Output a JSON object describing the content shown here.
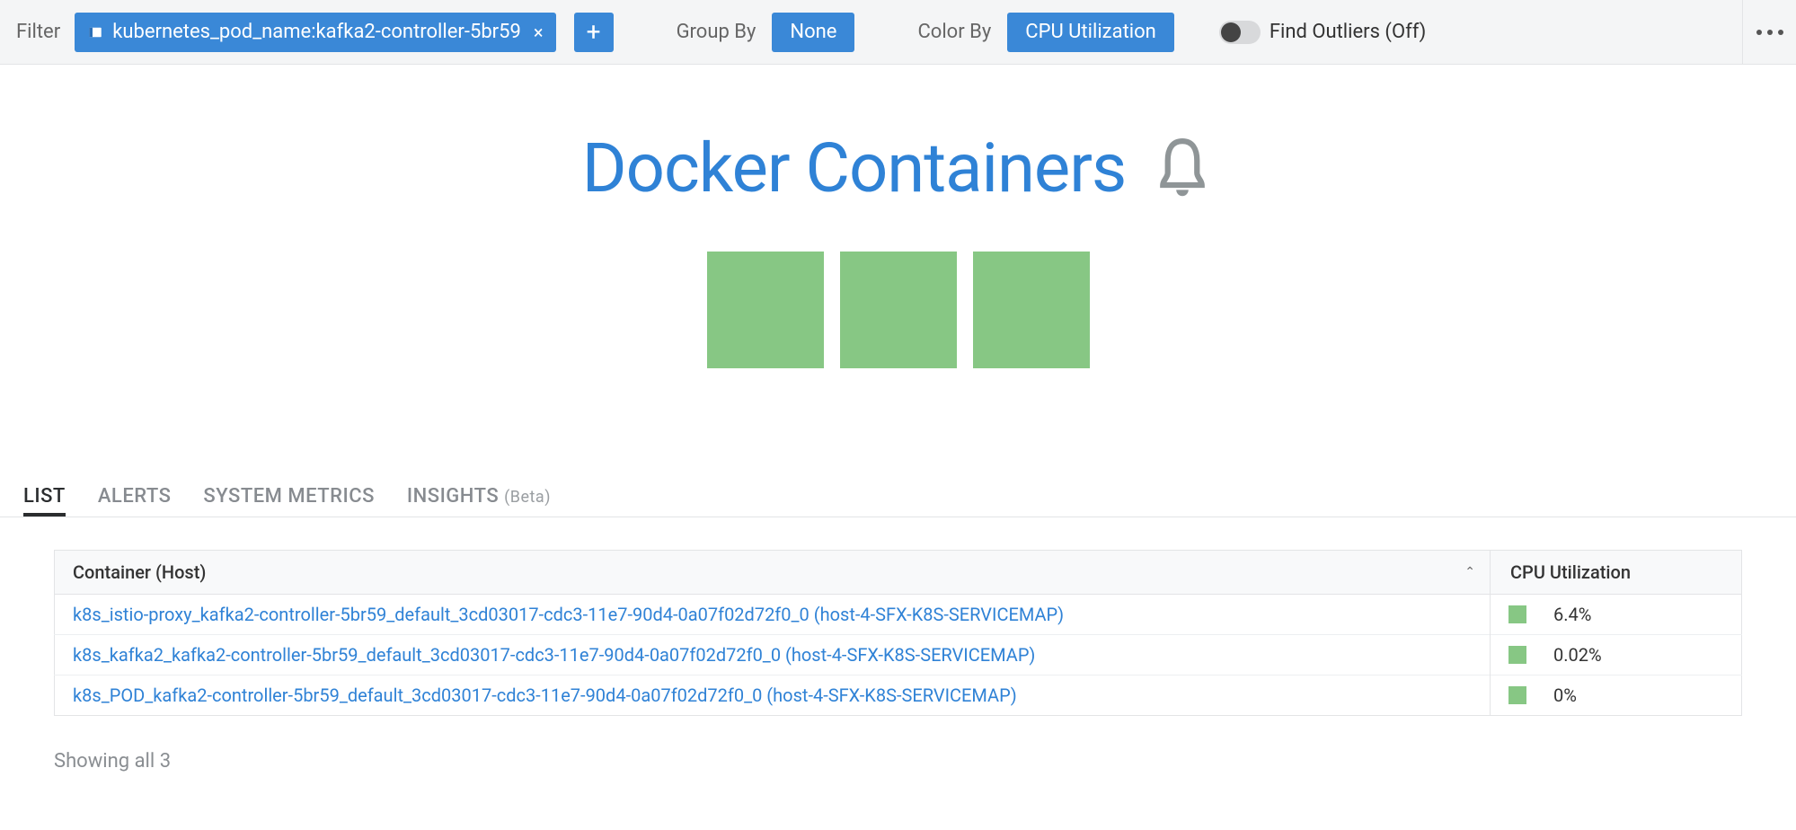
{
  "toolbar": {
    "filter_label": "Filter",
    "filter_chip": "kubernetes_pod_name:kafka2-controller-5br59",
    "group_by_label": "Group By",
    "group_by_value": "None",
    "color_by_label": "Color By",
    "color_by_value": "CPU Utilization",
    "outliers_label": "Find Outliers (Off)"
  },
  "viz": {
    "title": "Docker Containers"
  },
  "tabs": {
    "list": "LIST",
    "alerts": "ALERTS",
    "system_metrics": "SYSTEM METRICS",
    "insights": "INSIGHTS",
    "insights_suffix": "(Beta)"
  },
  "table": {
    "col_container": "Container (Host)",
    "col_cpu": "CPU Utilization",
    "rows": [
      {
        "name": "k8s_istio-proxy_kafka2-controller-5br59_default_3cd03017-cdc3-11e7-90d4-0a07f02d72f0_0 (host-4-SFX-K8S-SERVICEMAP)",
        "cpu": "6.4%"
      },
      {
        "name": "k8s_kafka2_kafka2-controller-5br59_default_3cd03017-cdc3-11e7-90d4-0a07f02d72f0_0 (host-4-SFX-K8S-SERVICEMAP)",
        "cpu": "0.02%"
      },
      {
        "name": "k8s_POD_kafka2-controller-5br59_default_3cd03017-cdc3-11e7-90d4-0a07f02d72f0_0 (host-4-SFX-K8S-SERVICEMAP)",
        "cpu": "0%"
      }
    ],
    "showing": "Showing all 3"
  }
}
